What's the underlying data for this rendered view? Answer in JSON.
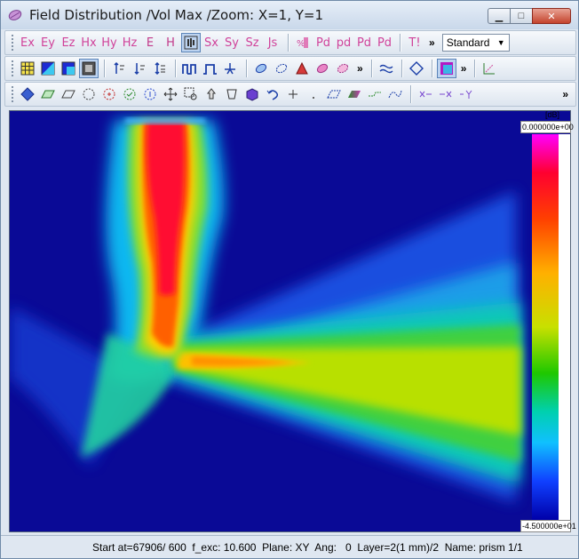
{
  "window": {
    "title": "Field Distribution /Vol Max /Zoom: X=1, Y=1",
    "minimize_label": "▁",
    "maximize_label": "□",
    "close_label": "✕"
  },
  "toolbar1": {
    "field_buttons": [
      {
        "id": "ex",
        "label": "Ex"
      },
      {
        "id": "ey",
        "label": "Ey"
      },
      {
        "id": "ez",
        "label": "Ez"
      },
      {
        "id": "hx",
        "label": "Hx"
      },
      {
        "id": "hy",
        "label": "Hy"
      },
      {
        "id": "hz",
        "label": "Hz"
      },
      {
        "id": "e",
        "label": "E"
      },
      {
        "id": "h",
        "label": "H"
      }
    ],
    "power_buttons": [
      {
        "id": "sx",
        "label": "Sx"
      },
      {
        "id": "sy",
        "label": "Sy"
      },
      {
        "id": "sz",
        "label": "Sz"
      },
      {
        "id": "js",
        "label": "Js"
      }
    ],
    "pd_buttons": [
      {
        "id": "pd1",
        "label": "Pd"
      },
      {
        "id": "pd2",
        "label": "pd"
      },
      {
        "id": "pd3",
        "label": "Pd"
      },
      {
        "id": "pd4",
        "label": "Pd"
      }
    ],
    "t_label": "T!",
    "more": "»",
    "view_select": "Standard",
    "view_select_arrow": "▼"
  },
  "toolbar_more": "»",
  "colorbar": {
    "unit": "[dB]",
    "max_label": "0.000000e+00",
    "min_label": "-4.500000e+01"
  },
  "status": {
    "text": "Start at=67906/ 600  f_exc: 10.600  Plane: XY  Ang:   0  Layer=2(1 mm)/2  Name: prism 1/1"
  }
}
